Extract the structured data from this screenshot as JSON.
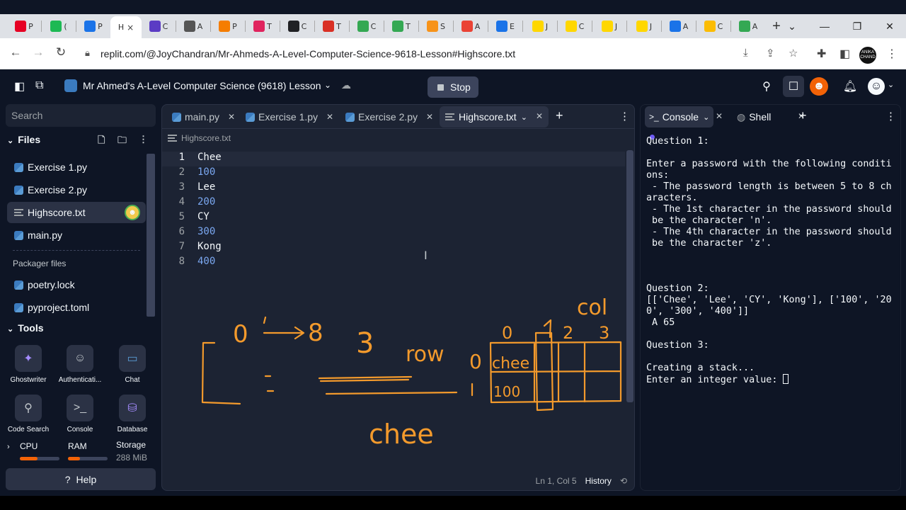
{
  "browser": {
    "tabs": [
      {
        "icon": "pinterest-icon",
        "label": "P",
        "color": "#e60023"
      },
      {
        "icon": "green-circle-icon",
        "label": "(",
        "color": "#1db954"
      },
      {
        "icon": "z-icon",
        "label": "P",
        "color": "#1a73e8"
      },
      {
        "icon": "active-tab",
        "label": "H",
        "color": "#ffffff"
      },
      {
        "icon": "list-icon",
        "label": "C",
        "color": "#5b3cc4"
      },
      {
        "icon": "hex-icon",
        "label": "A",
        "color": "#555555"
      },
      {
        "icon": "blogger-icon",
        "label": "P",
        "color": "#f57d00"
      },
      {
        "icon": "tracker-icon",
        "label": "T",
        "color": "#e0245e"
      },
      {
        "icon": "monitor-icon",
        "label": "C",
        "color": "#202124"
      },
      {
        "icon": "pin-icon",
        "label": "T",
        "color": "#d93025"
      },
      {
        "icon": "green-square-icon",
        "label": "C",
        "color": "#34a853"
      },
      {
        "icon": "green-square-icon",
        "label": "T",
        "color": "#34a853"
      },
      {
        "icon": "bitcoin-icon",
        "label": "S",
        "color": "#f7931a"
      },
      {
        "icon": "mail-icon",
        "label": "A",
        "color": "#ea4335"
      },
      {
        "icon": "edge-icon",
        "label": "E",
        "color": "#1a73e8"
      },
      {
        "icon": "ukraine-icon",
        "label": "J",
        "color": "#ffd700"
      },
      {
        "icon": "ukraine-icon",
        "label": "C",
        "color": "#ffd700"
      },
      {
        "icon": "ukraine-icon",
        "label": "J",
        "color": "#ffd700"
      },
      {
        "icon": "ukraine-icon",
        "label": "J",
        "color": "#ffd700"
      },
      {
        "icon": "drive-icon",
        "label": "A",
        "color": "#1a73e8"
      },
      {
        "icon": "drive-icon",
        "label": "C",
        "color": "#fbbc04"
      },
      {
        "icon": "drive-icon",
        "label": "A",
        "color": "#34a853"
      }
    ],
    "active_tab_label": "H",
    "active_tab_close": "×",
    "new_tab": "+",
    "url": "replit.com/@JoyChandran/Mr-Ahmeds-A-Level-Computer-Science-9618-Lesson#Highscore.txt",
    "profile_text": "ANIKA CHAND"
  },
  "header": {
    "repl_name": "Mr Ahmed's A-Level Computer Science (9618) Lesson",
    "stop_label": "Stop"
  },
  "sidebar": {
    "search_placeholder": "Search",
    "files_title": "Files",
    "files": [
      "Exercise 1.py",
      "Exercise 2.py",
      "Highscore.txt",
      "main.py"
    ],
    "packager_title": "Packager files",
    "packager_files": [
      "poetry.lock",
      "pyproject.toml"
    ],
    "tools_title": "Tools",
    "tools": [
      "Ghostwriter",
      "Authenticati...",
      "Chat",
      "Code Search",
      "Console",
      "Database"
    ],
    "cpu_label": "CPU",
    "ram_label": "RAM",
    "storage_label": "Storage",
    "storage_value": "288 MiB",
    "cpu_usage": 0.45,
    "ram_usage": 0.3,
    "help_label": "Help"
  },
  "editor": {
    "tabs": [
      "main.py",
      "Exercise 1.py",
      "Exercise 2.py",
      "Highscore.txt"
    ],
    "breadcrumb": "Highscore.txt",
    "lines": [
      {
        "n": "1",
        "text": "Chee",
        "num": false
      },
      {
        "n": "2",
        "text": "100",
        "num": true
      },
      {
        "n": "3",
        "text": "Lee",
        "num": false
      },
      {
        "n": "4",
        "text": "200",
        "num": true
      },
      {
        "n": "5",
        "text": "CY",
        "num": false
      },
      {
        "n": "6",
        "text": "300",
        "num": true
      },
      {
        "n": "7",
        "text": "Kong",
        "num": false
      },
      {
        "n": "8",
        "text": "400",
        "num": true
      }
    ],
    "position": "Ln 1, Col 5",
    "history_label": "History",
    "annotation": {
      "color": "#f39a2c",
      "range_0": "0",
      "range_8": "8",
      "three": "3",
      "row": "row",
      "col": "col",
      "col_indices": [
        "0",
        "1",
        "2",
        "3"
      ],
      "row_indices": [
        "0",
        "1"
      ],
      "cell_chee": "chee",
      "cell_100": "100",
      "word_chee": "chee"
    }
  },
  "console": {
    "tab_console": "Console",
    "tab_shell": "Shell",
    "output": "Question 1:\n\nEnter a password with the following conditi\nons:\n - The password length is between 5 to 8 ch\naracters.\n - The 1st character in the password should\n be the character 'n'.\n - The 4th character in the password should\n be the character 'z'.\n\n\n\nQuestion 2:\n[['Chee', 'Lee', 'CY', 'Kong'], ['100', '20\n0', '300', '400']]\n A 65\n\nQuestion 3:\n\nCreating a stack...\nEnter an integer value: "
  }
}
